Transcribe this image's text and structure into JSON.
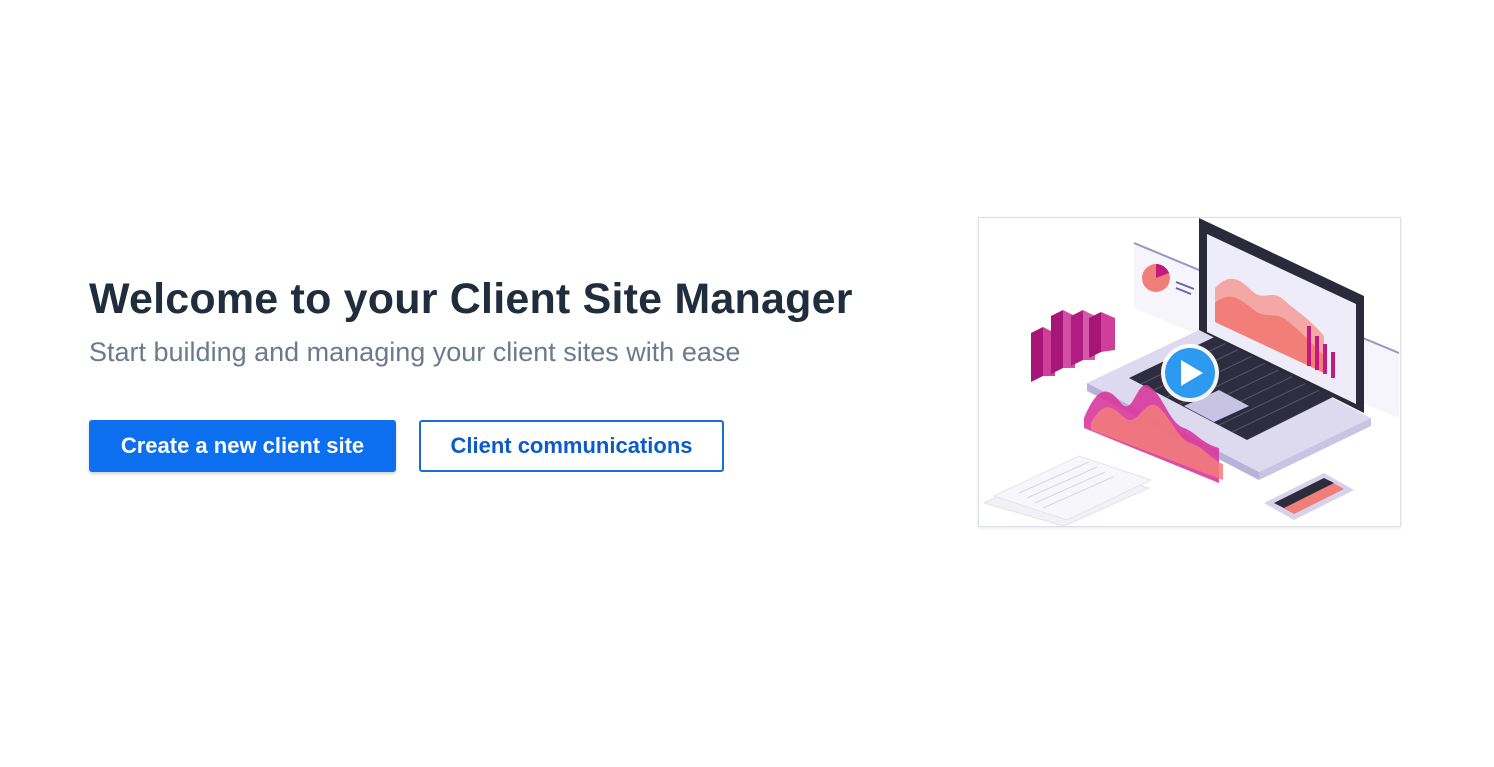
{
  "welcome": {
    "title": "Welcome to your Client Site Manager",
    "subtitle": "Start building and managing your client sites with ease"
  },
  "actions": {
    "create_label": "Create a new client site",
    "communications_label": "Client communications"
  },
  "video": {
    "play_icon": "play-icon"
  },
  "colors": {
    "primary": "#0b6ff0",
    "secondary_border": "#1a6dd8",
    "title": "#1f2d3d",
    "subtitle": "#6b7a8c",
    "play_button": "#2c9af0"
  }
}
